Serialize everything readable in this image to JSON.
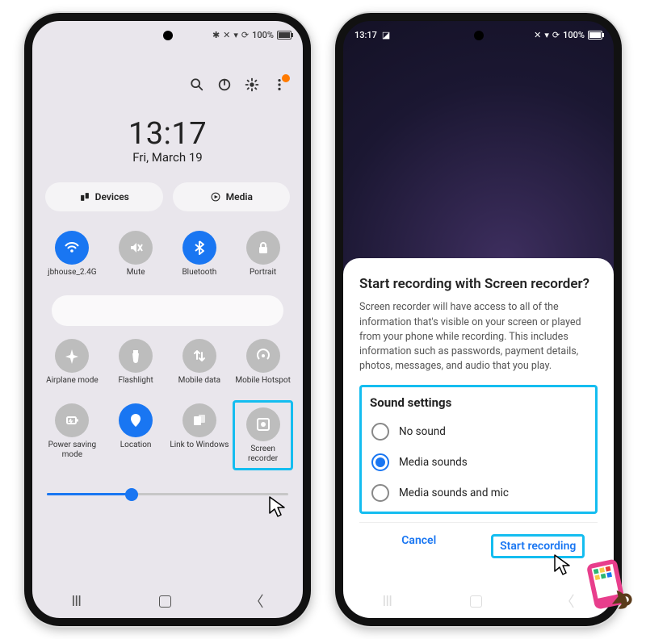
{
  "statusbar_left": {
    "time": "13:17",
    "pic_indicator": "◪"
  },
  "statusbar_right": {
    "bt": "✱",
    "wifi_off": "✕",
    "signal": "▾",
    "rotate": "⟳",
    "battery_pct": "100%"
  },
  "topbar": {
    "search_icon": "search",
    "power_icon": "power",
    "settings_icon": "settings",
    "more_icon": "more"
  },
  "clock": {
    "time": "13:17",
    "date": "Fri, March 19"
  },
  "pills": {
    "devices": "Devices",
    "media": "Media"
  },
  "tiles": {
    "row1": [
      {
        "key": "wifi",
        "label": "jbhouse_2.4G",
        "active": true
      },
      {
        "key": "mute",
        "label": "Mute",
        "active": false
      },
      {
        "key": "bluetooth",
        "label": "Bluetooth",
        "active": true
      },
      {
        "key": "portrait",
        "label": "Portrait",
        "active": false
      }
    ],
    "row2": [
      {
        "key": "airplane",
        "label": "Airplane mode",
        "active": false
      },
      {
        "key": "flashlight",
        "label": "Flashlight",
        "active": false
      },
      {
        "key": "mobiledata",
        "label": "Mobile data",
        "active": false
      },
      {
        "key": "hotspot",
        "label": "Mobile Hotspot",
        "active": false
      }
    ],
    "row3": [
      {
        "key": "powersave",
        "label": "Power saving mode",
        "active": false
      },
      {
        "key": "location",
        "label": "Location",
        "active": true
      },
      {
        "key": "linkwin",
        "label": "Link to Windows",
        "active": false
      },
      {
        "key": "screenrec",
        "label": "Screen recorder",
        "active": false,
        "highlight": true
      }
    ]
  },
  "brightness_pct": 35,
  "sheet": {
    "title": "Start recording with Screen recorder?",
    "body": "Screen recorder will have access to all of the information that's visible on your screen or played from your phone while recording. This includes information such as passwords, payment details, photos, messages, and audio that you play.",
    "sound_heading": "Sound settings",
    "options": [
      {
        "key": "none",
        "label": "No sound",
        "selected": false
      },
      {
        "key": "media",
        "label": "Media sounds",
        "selected": true
      },
      {
        "key": "mediamic",
        "label": "Media sounds and mic",
        "selected": false
      }
    ],
    "cancel": "Cancel",
    "start": "Start recording"
  }
}
